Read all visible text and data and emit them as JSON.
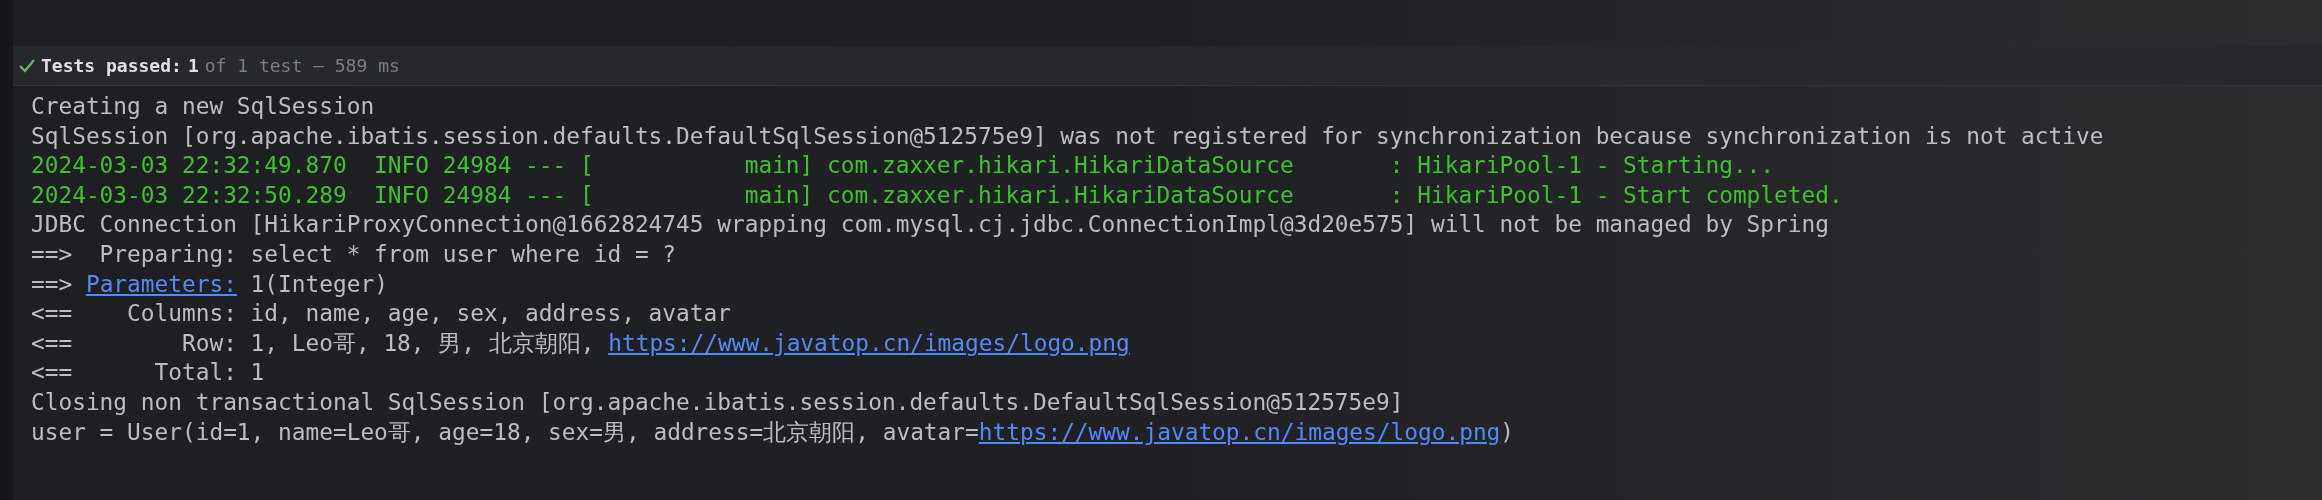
{
  "test_status": {
    "passed": true,
    "label": "Tests passed:",
    "count": "1",
    "detail": "of 1 test – 589 ms"
  },
  "console_lines": [
    {
      "info": false,
      "segments": [
        {
          "kind": "text",
          "text": "Creating a new SqlSession"
        }
      ]
    },
    {
      "info": false,
      "segments": [
        {
          "kind": "text",
          "text": "SqlSession [org.apache.ibatis.session.defaults.DefaultSqlSession@512575e9] was not registered for synchronization because synchronization is not active"
        }
      ]
    },
    {
      "info": true,
      "segments": [
        {
          "kind": "text",
          "text": "2024-03-03 22:32:49.870  INFO 24984 --- [           main] com.zaxxer.hikari.HikariDataSource       : HikariPool-1 - Starting..."
        }
      ]
    },
    {
      "info": true,
      "segments": [
        {
          "kind": "text",
          "text": "2024-03-03 22:32:50.289  INFO 24984 --- [           main] com.zaxxer.hikari.HikariDataSource       : HikariPool-1 - Start completed."
        }
      ]
    },
    {
      "info": false,
      "segments": [
        {
          "kind": "text",
          "text": "JDBC Connection [HikariProxyConnection@1662824745 wrapping com.mysql.cj.jdbc.ConnectionImpl@3d20e575] will not be managed by Spring"
        }
      ]
    },
    {
      "info": false,
      "segments": [
        {
          "kind": "text",
          "text": "==>  Preparing: select * from user where id = ?"
        }
      ]
    },
    {
      "info": false,
      "segments": [
        {
          "kind": "text",
          "text": "==> "
        },
        {
          "kind": "link",
          "text": "Parameters:"
        },
        {
          "kind": "text",
          "text": " 1(Integer)"
        }
      ]
    },
    {
      "info": false,
      "segments": [
        {
          "kind": "text",
          "text": "<==    Columns: id, name, age, sex, address, avatar"
        }
      ]
    },
    {
      "info": false,
      "segments": [
        {
          "kind": "text",
          "text": "<==        Row: 1, Leo哥, 18, 男, 北京朝阳, "
        },
        {
          "kind": "link",
          "text": "https://www.javatop.cn/images/logo.png"
        }
      ]
    },
    {
      "info": false,
      "segments": [
        {
          "kind": "text",
          "text": "<==      Total: 1"
        }
      ]
    },
    {
      "info": false,
      "segments": [
        {
          "kind": "text",
          "text": "Closing non transactional SqlSession [org.apache.ibatis.session.defaults.DefaultSqlSession@512575e9]"
        }
      ]
    },
    {
      "info": false,
      "segments": [
        {
          "kind": "text",
          "text": "user = User(id=1, name=Leo哥, age=18, sex=男, address=北京朝阳, avatar="
        },
        {
          "kind": "link",
          "text": "https://www.javatop.cn/images/logo.png"
        },
        {
          "kind": "text",
          "text": ")"
        }
      ]
    }
  ]
}
